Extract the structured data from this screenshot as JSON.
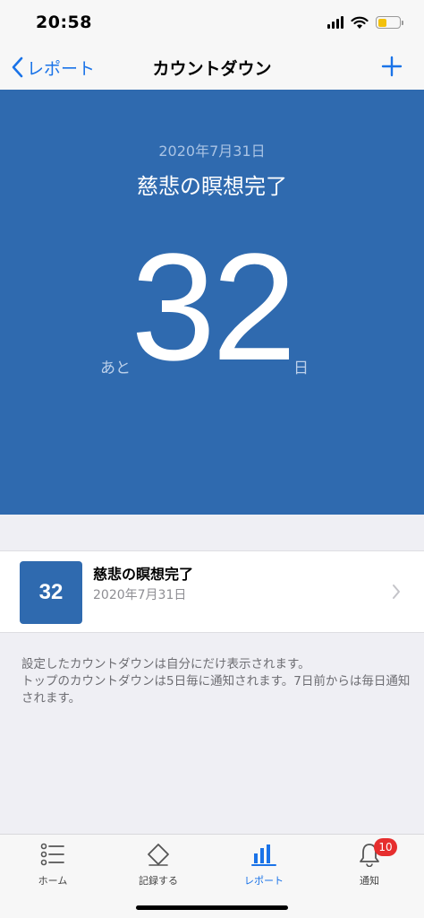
{
  "status_bar": {
    "time": "20:58"
  },
  "nav": {
    "back_label": "レポート",
    "title": "カウントダウン"
  },
  "hero": {
    "date": "2020年7月31日",
    "title": "慈悲の瞑想完了",
    "prefix": "あと",
    "number": "32",
    "suffix": "日"
  },
  "list": {
    "items": [
      {
        "badge": "32",
        "title": "慈悲の瞑想完了",
        "date": "2020年7月31日"
      }
    ]
  },
  "notes": [
    "設定したカウントダウンは自分にだけ表示されます。",
    "トップのカウントダウンは5日毎に通知されます。7日前からは毎日通知されます。"
  ],
  "tabs": [
    {
      "label": "ホーム",
      "icon": "list-icon"
    },
    {
      "label": "記録する",
      "icon": "tag-icon"
    },
    {
      "label": "レポート",
      "icon": "bar-chart-icon",
      "active": true
    },
    {
      "label": "通知",
      "icon": "bell-icon",
      "badge": "10"
    }
  ],
  "colors": {
    "accent": "#1a73e8",
    "hero_bg": "#2f6aaf",
    "badge_red": "#e62e2e"
  }
}
